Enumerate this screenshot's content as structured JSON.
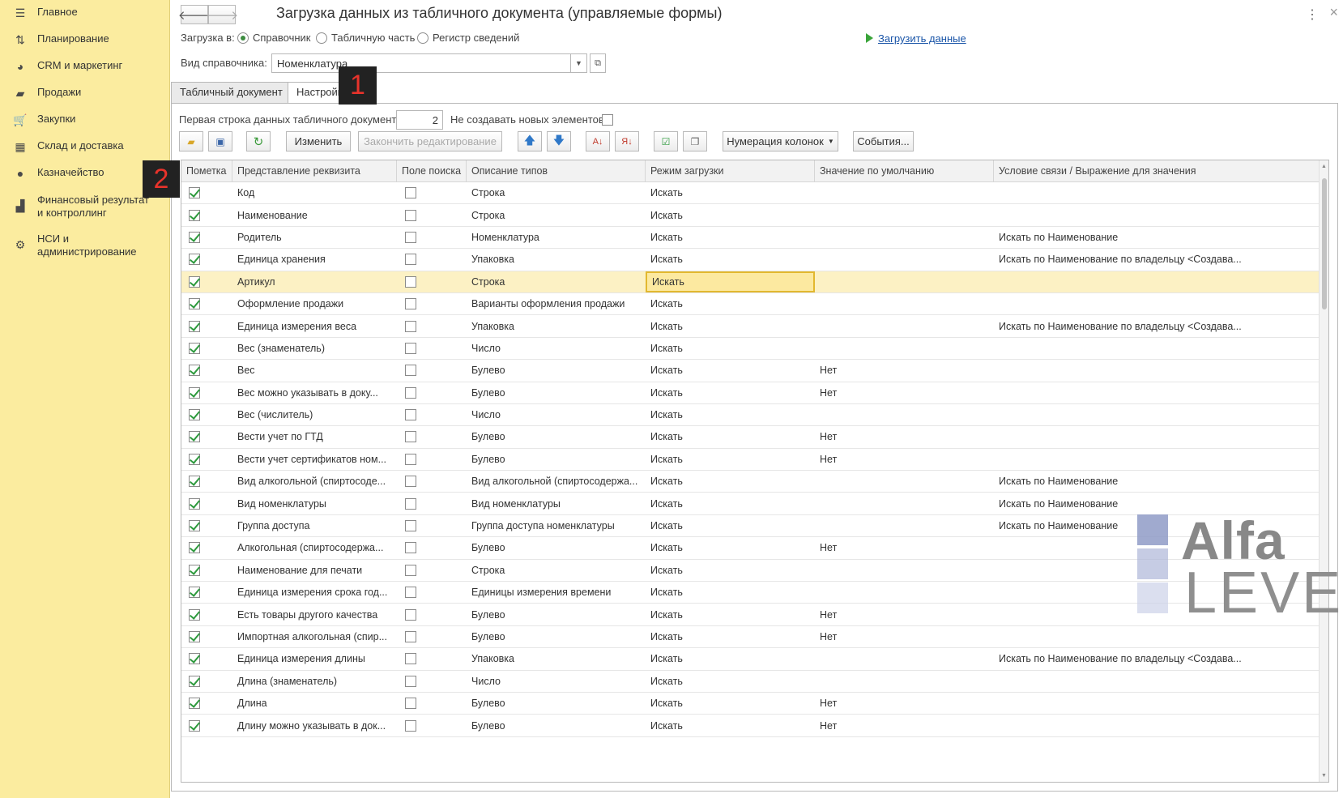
{
  "sidebar": {
    "items": [
      {
        "label": "Главное",
        "icon": "menu-icon"
      },
      {
        "label": "Планирование",
        "icon": "planning-icon"
      },
      {
        "label": "CRM и маркетинг",
        "icon": "crm-icon"
      },
      {
        "label": "Продажи",
        "icon": "sales-bag-icon"
      },
      {
        "label": "Закупки",
        "icon": "cart-icon"
      },
      {
        "label": "Склад и доставка",
        "icon": "warehouse-icon"
      },
      {
        "label": "Казначейство",
        "icon": "treasury-coin-icon"
      },
      {
        "label": "Финансовый результат и контроллинг",
        "icon": "bar-chart-icon"
      },
      {
        "label": "НСИ и администрирование",
        "icon": "gear-icon"
      }
    ]
  },
  "header": {
    "title": "Загрузка данных из табличного документа (управляемые формы)",
    "back_icon": "arrow-left-icon",
    "forward_icon": "arrow-right-icon"
  },
  "form": {
    "load_to_label": "Загрузка в:",
    "radio_options": [
      "Справочник",
      "Табличную часть",
      "Регистр сведений"
    ],
    "radio_selected": "Справочник",
    "load_link": "Загрузить данные",
    "ref_type_label": "Вид справочника:",
    "ref_type_value": "Номенклатура"
  },
  "tabs": [
    "Табличный документ",
    "Настройка"
  ],
  "badges": [
    "1",
    "2"
  ],
  "settings": {
    "first_row_label": "Первая строка данных табличного документа:",
    "first_row_value": "2",
    "no_new_label": "Не создавать новых элементов:"
  },
  "toolbar": {
    "change": "Изменить",
    "finish_edit": "Закончить редактирование",
    "numbering": "Нумерация колонок",
    "events": "События..."
  },
  "table": {
    "headers": [
      "Пометка",
      "Представление реквизита",
      "Поле поиска",
      "Описание типов",
      "Режим загрузки",
      "Значение по умолчанию",
      "Условие связи / Выражение для значения"
    ],
    "rows": [
      {
        "name": "Код",
        "type": "Строка",
        "mode": "Искать",
        "def": "",
        "cond": ""
      },
      {
        "name": "Наименование",
        "type": "Строка",
        "mode": "Искать",
        "def": "",
        "cond": ""
      },
      {
        "name": "Родитель",
        "type": "Номенклатура",
        "mode": "Искать",
        "def": "",
        "cond": "Искать по Наименование"
      },
      {
        "name": "Единица хранения",
        "type": "Упаковка",
        "mode": "Искать",
        "def": "",
        "cond": "Искать по Наименование по владельцу <Создава..."
      },
      {
        "name": "Артикул",
        "type": "Строка",
        "mode": "Искать",
        "def": "",
        "cond": ""
      },
      {
        "name": "Оформление продажи",
        "type": "Варианты оформления продажи",
        "mode": "Искать",
        "def": "",
        "cond": ""
      },
      {
        "name": "Единица измерения веса",
        "type": "Упаковка",
        "mode": "Искать",
        "def": "",
        "cond": "Искать по Наименование по владельцу <Создава..."
      },
      {
        "name": "Вес (знаменатель)",
        "type": "Число",
        "mode": "Искать",
        "def": "",
        "cond": ""
      },
      {
        "name": "Вес",
        "type": "Булево",
        "mode": "Искать",
        "def": "Нет",
        "cond": ""
      },
      {
        "name": "Вес можно указывать в доку...",
        "type": "Булево",
        "mode": "Искать",
        "def": "Нет",
        "cond": ""
      },
      {
        "name": "Вес (числитель)",
        "type": "Число",
        "mode": "Искать",
        "def": "",
        "cond": ""
      },
      {
        "name": "Вести учет по ГТД",
        "type": "Булево",
        "mode": "Искать",
        "def": "Нет",
        "cond": ""
      },
      {
        "name": "Вести учет сертификатов ном...",
        "type": "Булево",
        "mode": "Искать",
        "def": "Нет",
        "cond": ""
      },
      {
        "name": "Вид алкогольной (спиртосоде...",
        "type": "Вид алкогольной (спиртосодержа...",
        "mode": "Искать",
        "def": "",
        "cond": "Искать по Наименование"
      },
      {
        "name": "Вид номенклатуры",
        "type": "Вид номенклатуры",
        "mode": "Искать",
        "def": "",
        "cond": "Искать по Наименование"
      },
      {
        "name": "Группа доступа",
        "type": "Группа доступа номенклатуры",
        "mode": "Искать",
        "def": "",
        "cond": "Искать по Наименование"
      },
      {
        "name": "Алкогольная (спиртосодержа...",
        "type": "Булево",
        "mode": "Искать",
        "def": "Нет",
        "cond": ""
      },
      {
        "name": "Наименование для печати",
        "type": "Строка",
        "mode": "Искать",
        "def": "",
        "cond": ""
      },
      {
        "name": "Единица измерения срока год...",
        "type": "Единицы измерения времени",
        "mode": "Искать",
        "def": "",
        "cond": ""
      },
      {
        "name": "Есть товары другого качества",
        "type": "Булево",
        "mode": "Искать",
        "def": "Нет",
        "cond": ""
      },
      {
        "name": "Импортная алкогольная (спир...",
        "type": "Булево",
        "mode": "Искать",
        "def": "Нет",
        "cond": ""
      },
      {
        "name": "Единица измерения длины",
        "type": "Упаковка",
        "mode": "Искать",
        "def": "",
        "cond": "Искать по Наименование по владельцу <Создава..."
      },
      {
        "name": "Длина (знаменатель)",
        "type": "Число",
        "mode": "Искать",
        "def": "",
        "cond": ""
      },
      {
        "name": "Длина",
        "type": "Булево",
        "mode": "Искать",
        "def": "Нет",
        "cond": ""
      },
      {
        "name": "Длину можно указывать в док...",
        "type": "Булево",
        "mode": "Искать",
        "def": "Нет",
        "cond": ""
      }
    ]
  },
  "watermark": {
    "line1": "Alfa",
    "line2": "LEVEL"
  },
  "colors": {
    "sidebar_bg": "#fbec9f",
    "selected_row": "#fcf1c4",
    "active_cell": "#fce9a0",
    "check_green": "#2e9a3e",
    "link_blue": "#1a55a8",
    "badge_red": "#e8332b"
  }
}
